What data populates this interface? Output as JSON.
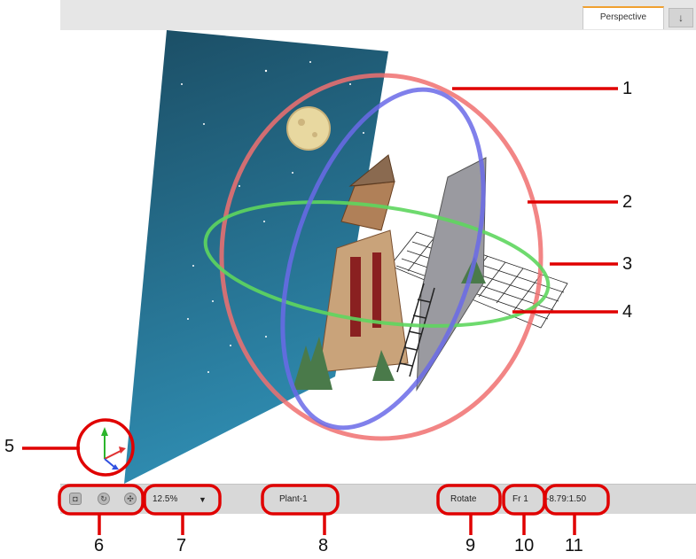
{
  "tabs": {
    "active": "Perspective"
  },
  "icons": {
    "tab_menu": "down-arrow-icon",
    "axis": "xyz-axis-icon",
    "cam": "camera-icon",
    "reset_rotate": "rotate-icon",
    "reset_all": "reset-icon"
  },
  "status": {
    "zoom": "12.5%",
    "layer": "Plant-1",
    "tool": "Rotate",
    "frame": "Fr 1",
    "coords": "-8.79:1.50"
  },
  "callouts": [
    "1",
    "2",
    "3",
    "4",
    "5",
    "6",
    "7",
    "8",
    "9",
    "10",
    "11"
  ],
  "colors": {
    "accent_tab": "#f0a030",
    "callout_red": "#e00000",
    "ring_red": "#f07070",
    "ring_blue": "#6a6ae8",
    "ring_green": "#5ed65e",
    "sky_top": "#1b4d64",
    "sky_bottom": "#2f8db2"
  }
}
